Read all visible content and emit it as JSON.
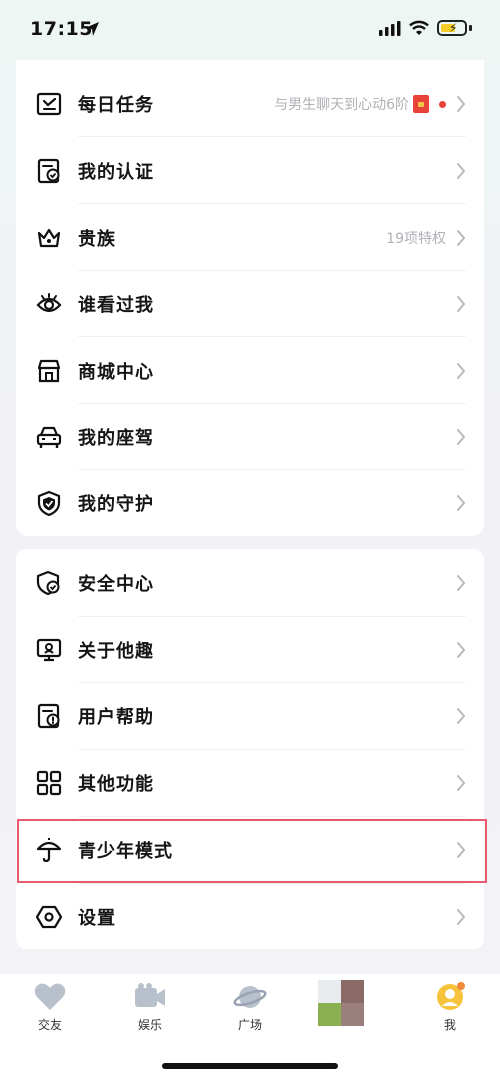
{
  "status": {
    "time": "17:15"
  },
  "menu_main": [
    {
      "label": "每日任务",
      "meta": "与男生聊天到心动6阶",
      "icon": "task-icon"
    },
    {
      "label": "我的认证",
      "meta": "",
      "icon": "verify-icon"
    },
    {
      "label": "贵族",
      "meta": "19项特权",
      "icon": "crown-icon"
    },
    {
      "label": "谁看过我",
      "meta": "",
      "icon": "eye-icon"
    },
    {
      "label": "商城中心",
      "meta": "",
      "icon": "store-icon"
    },
    {
      "label": "我的座驾",
      "meta": "",
      "icon": "car-icon"
    },
    {
      "label": "我的守护",
      "meta": "",
      "icon": "shield-icon"
    }
  ],
  "menu_secondary": [
    {
      "label": "安全中心",
      "icon": "security-icon"
    },
    {
      "label": "关于他趣",
      "icon": "about-icon"
    },
    {
      "label": "用户帮助",
      "icon": "help-icon"
    },
    {
      "label": "其他功能",
      "icon": "grid-icon"
    },
    {
      "label": "青少年模式",
      "icon": "umbrella-icon"
    },
    {
      "label": "设置",
      "icon": "settings-icon"
    }
  ],
  "tabs": [
    {
      "label": "交友",
      "icon": "heart-icon"
    },
    {
      "label": "娱乐",
      "icon": "video-icon"
    },
    {
      "label": "广场",
      "icon": "planet-icon"
    },
    {
      "label": "我",
      "icon": "avatar-icon"
    }
  ]
}
